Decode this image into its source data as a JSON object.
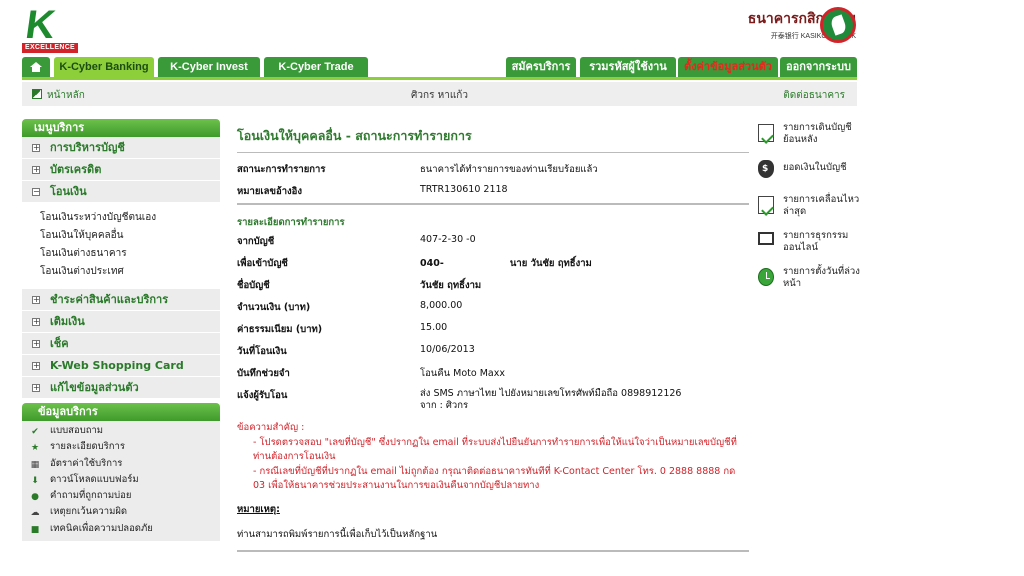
{
  "header": {
    "logo_k": "K",
    "logo_tag": "EXCELLENCE",
    "bank_name_thai": "ธนาคารกสิกรไทย",
    "bank_name_sub": "开泰银行 KASIKORNBANK",
    "colors": {
      "brand_green": "#3a9a3a",
      "accent_green": "#8ccf3a",
      "brand_red": "#d2232a"
    }
  },
  "tabs_left": [
    {
      "label": "K-Cyber Banking",
      "active": true
    },
    {
      "label": "K-Cyber Invest",
      "active": false
    },
    {
      "label": "K-Cyber Trade",
      "active": false
    }
  ],
  "tabs_right": [
    {
      "label": "สมัครบริการ"
    },
    {
      "label": "รวมรหัสผู้ใช้งาน"
    },
    {
      "label": "ตั้งค่าข้อมูลส่วนตัว"
    },
    {
      "label": "ออกจากระบบ"
    }
  ],
  "breadcrumb": {
    "home": "หน้าหลัก",
    "user": "ศิวกร หาแก้ว",
    "contact": "ติดต่อธนาคาร"
  },
  "menu": {
    "title": "เมนูบริการ",
    "items_top": [
      {
        "label": "การบริหารบัญชี",
        "sign": "+"
      },
      {
        "label": "บัตรเครดิต",
        "sign": "+"
      },
      {
        "label": "โอนเงิน",
        "sign": "−"
      }
    ],
    "sub_transfer": [
      "โอนเงินระหว่างบัญชีตนเอง",
      "โอนเงินให้บุคคลอื่น",
      "โอนเงินต่างธนาคาร",
      "โอนเงินต่างประเทศ"
    ],
    "items_bottom": [
      {
        "label": "ชำระค่าสินค้าและบริการ",
        "sign": "+"
      },
      {
        "label": "เติมเงิน",
        "sign": "+"
      },
      {
        "label": "เช็ค",
        "sign": "+"
      },
      {
        "label": "K-Web Shopping Card",
        "sign": "+"
      },
      {
        "label": "แก้ไขข้อมูลส่วนตัว",
        "sign": "+"
      }
    ]
  },
  "info": {
    "title": "ข้อมูลบริการ",
    "items": [
      {
        "label": "แบบสอบถาม",
        "icon": "check-icon"
      },
      {
        "label": "รายละเอียดบริการ",
        "icon": "star-icon"
      },
      {
        "label": "อัตราค่าใช้บริการ",
        "icon": "calculator-icon"
      },
      {
        "label": "ดาวน์โหลดแบบฟอร์ม",
        "icon": "download-icon"
      },
      {
        "label": "คำถามที่ถูกถามบ่อย",
        "icon": "faq-icon"
      },
      {
        "label": "เหตุยกเว้นความผิด",
        "icon": "disclaimer-icon"
      },
      {
        "label": "เทคนิคเพื่อความปลอดภัย",
        "icon": "lock-icon"
      }
    ]
  },
  "main": {
    "title": "โอนเงินให้บุคคลอื่น - สถานะการทำรายการ",
    "status_label": "สถานะการทำรายการ",
    "status_value": "ธนาคารได้ทำรายการของท่านเรียบร้อยแล้ว",
    "ref_label": "หมายเลขอ้างอิง",
    "ref_value": "TRTR130610     2118",
    "section_title": "รายละเอียดการทำรายการ",
    "from_label": "จากบัญชี",
    "from_value": "407-2-30      -0",
    "to_label": "เพื่อเข้าบัญชี",
    "to_value": "040-                    นาย วันชัย ฤทธิ์งาม",
    "name_label": "ชื่อบัญชี",
    "name_value": "วันชัย ฤทธิ์งาม",
    "amount_label": "จำนวนเงิน (บาท)",
    "amount_value": "8,000.00",
    "fee_label": "ค่าธรรมเนียม (บาท)",
    "fee_value": "15.00",
    "date_label": "วันที่โอนเงิน",
    "date_value": "10/06/2013",
    "memo_label": "บันทึกช่วยจำ",
    "memo_value": "โอนคืน Moto Maxx",
    "notify_label": "แจ้งผู้รับโอน",
    "notify_value": "ส่ง SMS ภาษาไทย ไปยังหมายเลขโทรศัพท์มือถือ 0898912126",
    "notify_value2": "จาก : ศิวกร",
    "notes_heading": "ข้อความสำคัญ :",
    "note1": "- โปรดตรวจสอบ \"เลขที่บัญชี\" ซึ่งปรากฏใน email ที่ระบบส่งไปยืนยันการทำรายการเพื่อให้แน่ใจว่าเป็นหมายเลขบัญชีที่ท่านต้องการโอนเงิน",
    "note2": "- กรณีเลขที่บัญชีที่ปรากฏใน email ไม่ถูกต้อง กรุณาติดต่อธนาคารทันทีที่ K-Contact Center โทร. 0 2888 8888 กด 03 เพื่อให้ธนาคารช่วยประสานงานในการขอเงินคืนจากบัญชีปลายทาง",
    "remark_heading": "หมายเหตุ:",
    "remark_text": "ท่านสามารถพิมพ์รายการนี้เพื่อเก็บไว้เป็นหลักฐาน"
  },
  "right_links": [
    {
      "label": "รายการเดินบัญชีย้อนหลัง",
      "icon": "statement-icon"
    },
    {
      "label": "ยอดเงินในบัญชี",
      "icon": "money-bag-icon"
    },
    {
      "label": "รายการเคลื่อนไหวล่าสุด",
      "icon": "recent-activity-icon"
    },
    {
      "label": "รายการธุรกรรมออนไลน์",
      "icon": "online-transaction-icon"
    },
    {
      "label": "รายการตั้งวันที่ล่วงหน้า",
      "icon": "scheduled-icon"
    }
  ]
}
